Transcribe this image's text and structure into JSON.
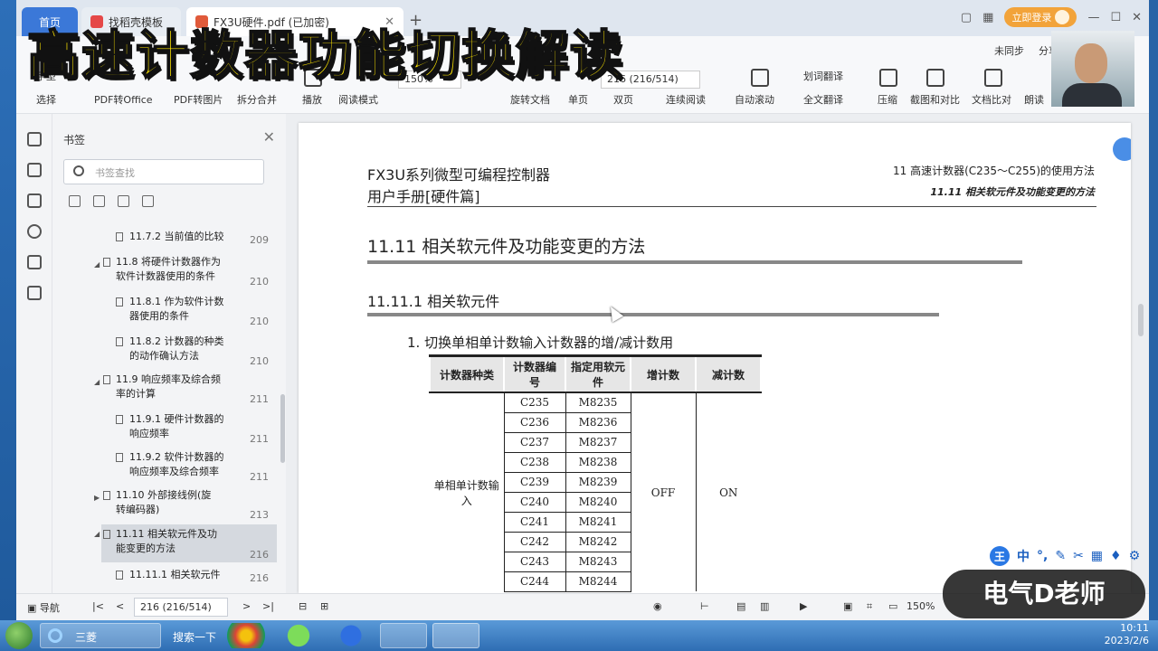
{
  "overlay": {
    "title": "高速计数器功能切换解读",
    "brand": "电气D老师"
  },
  "tabs": {
    "home": "首页",
    "template": "找稻壳模板",
    "pdf": "FX3U硬件.pdf (已加密)",
    "login": "立即登录"
  },
  "toolbar": {
    "sync": "未同步",
    "share": "分享",
    "select": "选择",
    "hand": "手型",
    "pdf_to_office": "PDF转Office",
    "pdf_to_image": "PDF转图片",
    "split_merge": "拆分合并",
    "play": "播放",
    "read_mode": "阅读模式",
    "zoom": "150%",
    "page_field": "216 (216/514)",
    "rotate": "旋转文档",
    "single_page": "单页",
    "double_page": "双页",
    "continuous": "连续阅读",
    "auto_scroll": "自动滚动",
    "word_translate": "划词翻译",
    "full_translate": "全文翻译",
    "compress": "压缩",
    "screenshot_compare": "截图和对比",
    "doc_compare": "文档比对",
    "read_aloud": "朗读"
  },
  "bookmarks": {
    "title": "书签",
    "search_placeholder": "书签查找",
    "items": [
      {
        "label": "11.7.2 当前值的比较",
        "page": "209"
      },
      {
        "label": "11.8 将硬件计数器作为软件计数器使用的条件",
        "page": "210"
      },
      {
        "label": "11.8.1 作为软件计数器使用的条件",
        "page": "210"
      },
      {
        "label": "11.8.2 计数器的种类的动作确认方法",
        "page": "210"
      },
      {
        "label": "11.9 响应频率及综合频率的计算",
        "page": "211"
      },
      {
        "label": "11.9.1 硬件计数器的响应频率",
        "page": "211"
      },
      {
        "label": "11.9.2 软件计数器的响应频率及综合频率",
        "page": "211"
      },
      {
        "label": "11.10 外部接线例(旋转编码器)",
        "page": "213"
      },
      {
        "label": "11.11 相关软元件及功能变更的方法",
        "page": "216"
      },
      {
        "label": "11.11.1 相关软元件",
        "page": "216"
      }
    ]
  },
  "document": {
    "header_left1": "FX3U系列微型可编程控制器",
    "header_left2": "用户手册[硬件篇]",
    "header_right1": "11 高速计数器(C235～C255)的使用方法",
    "header_right2": "11.11 相关软元件及功能变更的方法",
    "section_title": "11.11 相关软元件及功能变更的方法",
    "subsection_title": "11.11.1 相关软元件",
    "item_title": "1. 切换单相单计数输入计数器的增/减计数用",
    "table": {
      "headers": [
        "计数器种类",
        "计数器编号",
        "指定用软元件",
        "增计数",
        "减计数"
      ],
      "mode": "单相单计数输入",
      "up": "OFF",
      "down": "ON",
      "rows": [
        [
          "C235",
          "M8235"
        ],
        [
          "C236",
          "M8236"
        ],
        [
          "C237",
          "M8237"
        ],
        [
          "C238",
          "M8238"
        ],
        [
          "C239",
          "M8239"
        ],
        [
          "C240",
          "M8240"
        ],
        [
          "C241",
          "M8241"
        ],
        [
          "C242",
          "M8242"
        ],
        [
          "C243",
          "M8243"
        ],
        [
          "C244",
          "M8244"
        ]
      ]
    }
  },
  "statusbar": {
    "nav": "导航",
    "page_field": "216 (216/514)",
    "zoom": "150%"
  },
  "ime": {
    "badge": "王",
    "mode": "中"
  },
  "taskbar": {
    "ie_label": "三菱",
    "search": "搜索一下",
    "time": "10:11",
    "date": "2023/2/6"
  }
}
